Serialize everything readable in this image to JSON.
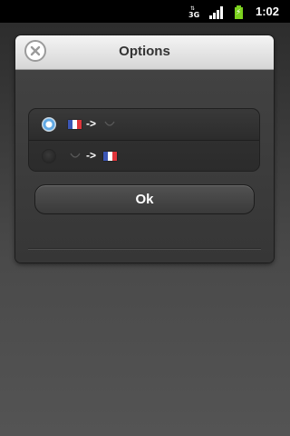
{
  "status_bar": {
    "network_arrows": "⇅",
    "network_type": "3G",
    "time": "1:02"
  },
  "dialog": {
    "title": "Options",
    "close_icon": "close-circle-icon",
    "options": [
      {
        "from_flag": "flag-france-icon",
        "arrow": "->",
        "to_flag": "flag-unknown-icon",
        "selected": true
      },
      {
        "from_flag": "flag-unknown-icon",
        "arrow": "->",
        "to_flag": "flag-france-icon",
        "selected": false
      }
    ],
    "ok_label": "Ok"
  },
  "colors": {
    "radio_selected": "#5fa8e4",
    "flag_blue": "#3b56b5",
    "flag_white": "#ffffff",
    "flag_red": "#e0353b",
    "battery": "#7cd21e"
  }
}
